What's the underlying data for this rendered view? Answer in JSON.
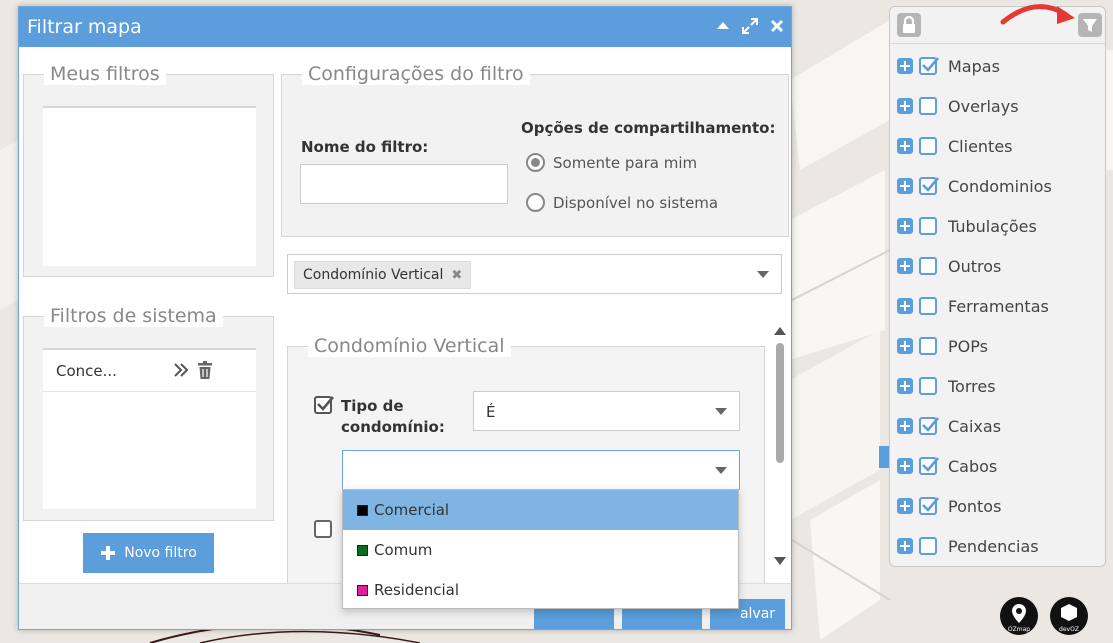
{
  "dialog": {
    "title": "Filtrar mapa",
    "my_filters": {
      "legend": "Meus filtros"
    },
    "system_filters": {
      "legend": "Filtros de sistema",
      "items": [
        {
          "label": "Conce..."
        }
      ]
    },
    "new_filter_label": "Novo filtro",
    "config": {
      "legend": "Configurações do filtro",
      "name_label": "Nome do filtro:",
      "name_value": "",
      "sharing_label": "Opções de compartilhamento:",
      "sharing_options": [
        {
          "label": "Somente para mim",
          "selected": true
        },
        {
          "label": "Disponível no sistema",
          "selected": false
        }
      ]
    },
    "layer_select": {
      "tag": "Condomínio Vertical"
    },
    "section": {
      "legend": "Condomínio Vertical",
      "field_label_line1": "Tipo de",
      "field_label_line2": "condomínio:",
      "field_checked": true,
      "operator_value": "É",
      "value_input": "",
      "second_checked": false
    },
    "dropdown_options": [
      {
        "label": "Comercial",
        "color": "#000000",
        "highlighted": true
      },
      {
        "label": "Comum",
        "color": "#0b6b1f",
        "highlighted": false
      },
      {
        "label": "Residencial",
        "color": "#e0209a",
        "highlighted": false
      }
    ],
    "footer": {
      "save_partial": "alvar"
    }
  },
  "layers": {
    "items": [
      {
        "label": "Mapas",
        "checked": true
      },
      {
        "label": "Overlays",
        "checked": false
      },
      {
        "label": "Clientes",
        "checked": false
      },
      {
        "label": "Condominios",
        "checked": true
      },
      {
        "label": "Tubulações",
        "checked": false
      },
      {
        "label": "Outros",
        "checked": false
      },
      {
        "label": "Ferramentas",
        "checked": false
      },
      {
        "label": "POPs",
        "checked": false
      },
      {
        "label": "Torres",
        "checked": false
      },
      {
        "label": "Caixas",
        "checked": true
      },
      {
        "label": "Cabos",
        "checked": true
      },
      {
        "label": "Pontos",
        "checked": true
      },
      {
        "label": "Pendencias",
        "checked": false
      }
    ]
  },
  "logos": {
    "ozmap": "OZmap",
    "devoz": "devOZ"
  },
  "colors": {
    "accent": "#5b9edb",
    "highlight": "#7fb4e3",
    "arrow": "#e53935"
  }
}
